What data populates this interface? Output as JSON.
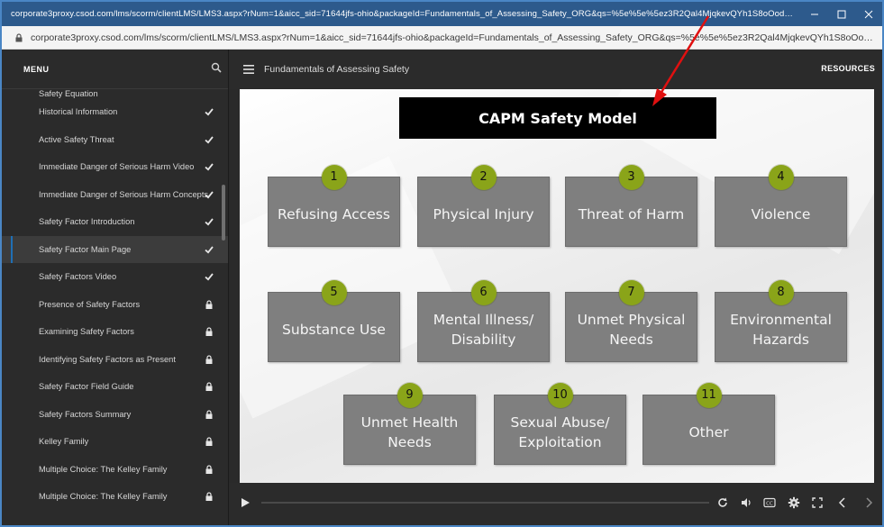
{
  "browser": {
    "title": "corporate3proxy.csod.com/lms/scorm/clientLMS/LMS3.aspx?rNum=1&aicc_sid=71644jfs-ohio&packageId=Fundamentals_of_Assessing_Safety_ORG&qs=%5e%5e%5ez3R2Qal4MjqkevQYh1S8oOodSibkDMtXmEFtOkLdHQqVEZgIXdfkZ5R8xP8SHqZ87xq32H...",
    "url": "corporate3proxy.csod.com/lms/scorm/clientLMS/LMS3.aspx?rNum=1&aicc_sid=71644jfs-ohio&packageId=Fundamentals_of_Assessing_Safety_ORG&qs=%5e%5e%5ez3R2Qal4MjqkevQYh1S8oOodSibkDMtXmEFtOkLdHQqVEZgIXdfkZ5R..."
  },
  "sidebar": {
    "title": "MENU",
    "items": [
      {
        "label": "Safety Equation",
        "status": "done"
      },
      {
        "label": "Historical Information",
        "status": "done"
      },
      {
        "label": "Active Safety Threat",
        "status": "done"
      },
      {
        "label": "Immediate Danger of Serious Harm Video",
        "status": "done"
      },
      {
        "label": "Immediate Danger of Serious Harm Concepts",
        "status": "done"
      },
      {
        "label": "Safety Factor Introduction",
        "status": "done"
      },
      {
        "label": "Safety Factor Main Page",
        "status": "done"
      },
      {
        "label": "Safety Factors Video",
        "status": "done"
      },
      {
        "label": "Presence of Safety Factors",
        "status": "locked"
      },
      {
        "label": "Examining Safety Factors",
        "status": "locked"
      },
      {
        "label": "Identifying Safety Factors as Present",
        "status": "locked"
      },
      {
        "label": "Safety Factor Field Guide",
        "status": "locked"
      },
      {
        "label": "Safety Factors Summary",
        "status": "locked"
      },
      {
        "label": "Kelley Family",
        "status": "locked"
      },
      {
        "label": "Multiple Choice: The Kelley Family",
        "status": "locked"
      },
      {
        "label": "Multiple Choice: The Kelley Family",
        "status": "locked"
      }
    ],
    "current_index": 6
  },
  "content": {
    "course_title": "Fundamentals of Assessing Safety",
    "resources_label": "RESOURCES"
  },
  "slide": {
    "title": "CAPM Safety Model",
    "cards": [
      {
        "num": "1",
        "label": "Refusing Access"
      },
      {
        "num": "2",
        "label": "Physical Injury"
      },
      {
        "num": "3",
        "label": "Threat of Harm"
      },
      {
        "num": "4",
        "label": "Violence"
      },
      {
        "num": "5",
        "label": "Substance Use"
      },
      {
        "num": "6",
        "label": "Mental Illness/ Disability"
      },
      {
        "num": "7",
        "label": "Unmet Physical Needs"
      },
      {
        "num": "8",
        "label": "Environmental Hazards"
      },
      {
        "num": "9",
        "label": "Unmet Health Needs"
      },
      {
        "num": "10",
        "label": "Sexual Abuse/ Exploitation"
      },
      {
        "num": "11",
        "label": "Other"
      }
    ]
  },
  "player": {
    "progress_fraction": 0.0
  },
  "colors": {
    "accent_blue": "#1f6fb5",
    "badge_green": "#8aa419",
    "card_gray": "#7f7f7f",
    "annotation_red": "#e01010"
  }
}
